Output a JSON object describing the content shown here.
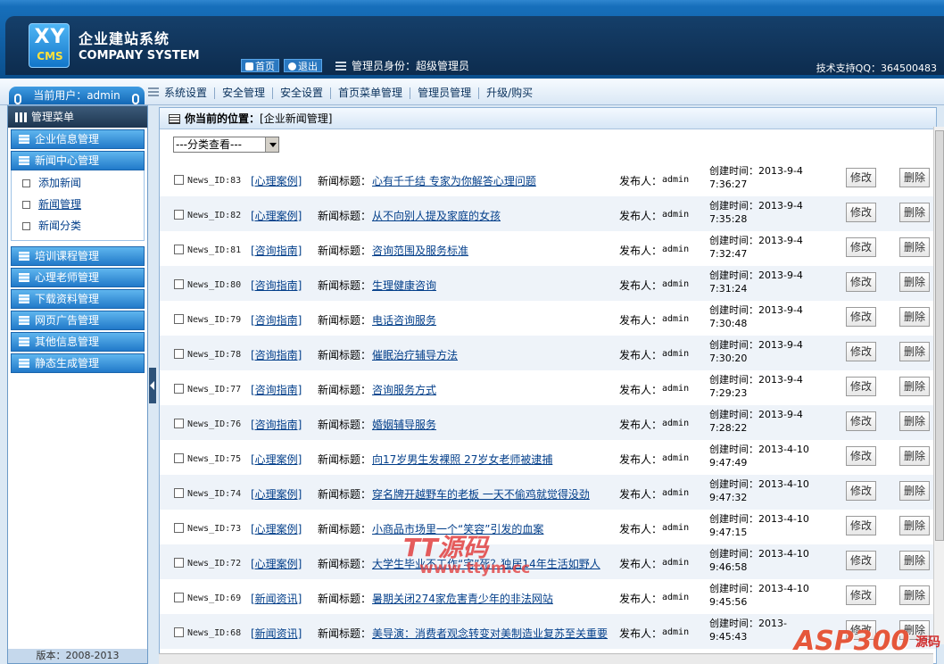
{
  "header": {
    "logo_xy": "XY",
    "logo_cms": "CMS",
    "brand_cn": "企业建站系统",
    "brand_en": "COMPANY SYSTEM",
    "home_label": "首页",
    "logout_label": "退出",
    "admin_identity": "管理员身份：超级管理员",
    "support": "技术支持QQ：364500483"
  },
  "nav": {
    "current_user": "当前用户：admin",
    "items": [
      "系统设置",
      "安全管理",
      "安全设置",
      "首页菜单管理",
      "管理员管理",
      "升级/购买"
    ]
  },
  "sidebar": {
    "menu_title": "管理菜单",
    "items_top": [
      "企业信息管理",
      "新闻中心管理"
    ],
    "sub_items": [
      "添加新闻",
      "新闻管理",
      "新闻分类"
    ],
    "items_bottom": [
      "培训课程管理",
      "心理老师管理",
      "下载资料管理",
      "网页广告管理",
      "其他信息管理",
      "静态生成管理"
    ],
    "version": "版本：2008-2013"
  },
  "main": {
    "location_label": "你当前的位置：",
    "location_value": "[企业新闻管理]",
    "filter_value": "---分类查看---",
    "title_label": "新闻标题：",
    "publisher_label": "发布人：",
    "created_label": "创建时间：",
    "edit_label": "修改",
    "delete_label": "删除"
  },
  "news": [
    {
      "id": "News_ID:83",
      "category": "[心理案例]",
      "title": "心有千千结 专家为你解答心理问题",
      "publisher": "admin",
      "date": "2013-9-4",
      "time": "7:36:27"
    },
    {
      "id": "News_ID:82",
      "category": "[心理案例]",
      "title": "从不向别人提及家庭的女孩",
      "publisher": "admin",
      "date": "2013-9-4",
      "time": "7:35:28"
    },
    {
      "id": "News_ID:81",
      "category": "[咨询指南]",
      "title": "咨询范围及服务标准",
      "publisher": "admin",
      "date": "2013-9-4",
      "time": "7:32:47"
    },
    {
      "id": "News_ID:80",
      "category": "[咨询指南]",
      "title": "生理健康咨询",
      "publisher": "admin",
      "date": "2013-9-4",
      "time": "7:31:24"
    },
    {
      "id": "News_ID:79",
      "category": "[咨询指南]",
      "title": "电话咨询服务",
      "publisher": "admin",
      "date": "2013-9-4",
      "time": "7:30:48"
    },
    {
      "id": "News_ID:78",
      "category": "[咨询指南]",
      "title": "催眠治疗辅导方法",
      "publisher": "admin",
      "date": "2013-9-4",
      "time": "7:30:20"
    },
    {
      "id": "News_ID:77",
      "category": "[咨询指南]",
      "title": "咨询服务方式",
      "publisher": "admin",
      "date": "2013-9-4",
      "time": "7:29:23"
    },
    {
      "id": "News_ID:76",
      "category": "[咨询指南]",
      "title": "婚姻辅导服务",
      "publisher": "admin",
      "date": "2013-9-4",
      "time": "7:28:22"
    },
    {
      "id": "News_ID:75",
      "category": "[心理案例]",
      "title": "向17岁男生发裸照 27岁女老师被逮捕",
      "publisher": "admin",
      "date": "2013-4-10",
      "time": "9:47:49"
    },
    {
      "id": "News_ID:74",
      "category": "[心理案例]",
      "title": "穿名牌开越野车的老板 一天不偷鸡就觉得没劲",
      "publisher": "admin",
      "date": "2013-4-10",
      "time": "9:47:32"
    },
    {
      "id": "News_ID:73",
      "category": "[心理案例]",
      "title": "小商品市场里一个“笑容”引发的血案",
      "publisher": "admin",
      "date": "2013-4-10",
      "time": "9:47:15"
    },
    {
      "id": "News_ID:72",
      "category": "[心理案例]",
      "title": "大学生毕业不工作“宅”死？独居14年生活如野人",
      "publisher": "admin",
      "date": "2013-4-10",
      "time": "9:46:58"
    },
    {
      "id": "News_ID:69",
      "category": "[新闻资讯]",
      "title": "暑期关闭274家危害青少年的非法网站",
      "publisher": "admin",
      "date": "2013-4-10",
      "time": "9:45:56"
    },
    {
      "id": "News_ID:68",
      "category": "[新闻资讯]",
      "title": "美导演：消费者观念转变对美制造业复苏至关重要",
      "publisher": "admin",
      "date": "2013-",
      "time": "9:45:43"
    }
  ],
  "watermarks": {
    "tt": "TT源码",
    "url": "www.ttym.cc",
    "asp": "ASP300",
    "asp_sub": "源码"
  }
}
